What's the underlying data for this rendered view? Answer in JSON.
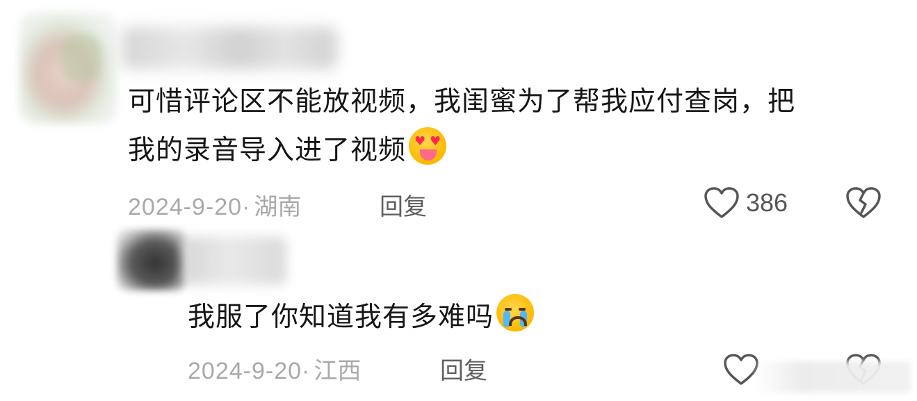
{
  "comments": [
    {
      "text_line1": "可惜评论区不能放视频，我闺蜜为了帮我应付查岗，把",
      "text_line2": "我的录音导入进了视频",
      "emoji": "heart-eyes-tongue-emoji",
      "date": "2024-9-20",
      "separator": "·",
      "location": "湖南",
      "reply_label": "回复",
      "like_count": "386"
    },
    {
      "text": "我服了你知道我有多难吗",
      "emoji": "loudly-crying-emoji",
      "date": "2024-9-20",
      "separator": "·",
      "location": "江西",
      "reply_label": "回复"
    }
  ],
  "icons": {
    "like": "heart-outline-icon",
    "dislike": "broken-heart-icon"
  },
  "colors": {
    "text": "#161616",
    "meta": "#a9a9a9",
    "icon": "#555555",
    "emoji_yellow": "#ffb800"
  }
}
